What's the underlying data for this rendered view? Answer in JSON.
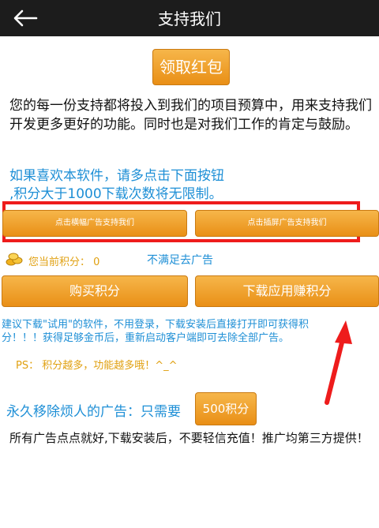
{
  "header": {
    "title": "支持我们",
    "back_icon": "arrow-left-icon"
  },
  "red_packet_button": "领取红包",
  "intro_text": "您的每一份支持都将投入到我们的项目预算中，用来支持我们开发更多更好的功能。同时也是对我们工作的肯定与鼓励。",
  "prompt": {
    "line1": "如果喜欢本软件，请多点击下面按钮",
    "line2": ",积分大于1000下载次数将无限制。"
  },
  "ad_buttons": {
    "banner": "点击横幅广告支持我们",
    "interstitial": "点击插屏广告支持我们"
  },
  "points": {
    "label": "您当前积分：",
    "value": "0",
    "not_enough_link": "不满足去广告"
  },
  "action_buttons": {
    "buy": "购买积分",
    "download_earn": "下载应用赚积分"
  },
  "suggestion_text": "建议下载\"试用\"的软件，不用登录，下载安装后直接打开即可获得积分！！！获得足够金币后，重新启动客户端即可去除全部广告。",
  "ps_text": "PS： 积分越多，功能越多哦！^_^",
  "remove_ads": {
    "label": "永久移除烦人的广告：只需要",
    "button": "500积分"
  },
  "footer_text": "所有广告点点就好,下载安装后，不要轻信充值！推广均第三方提供！",
  "colors": {
    "accent_orange": "#f0a02a",
    "blue_text": "#1e8fd6",
    "highlight_red": "#ee1c1c",
    "topbar": "#1c1c1c"
  }
}
